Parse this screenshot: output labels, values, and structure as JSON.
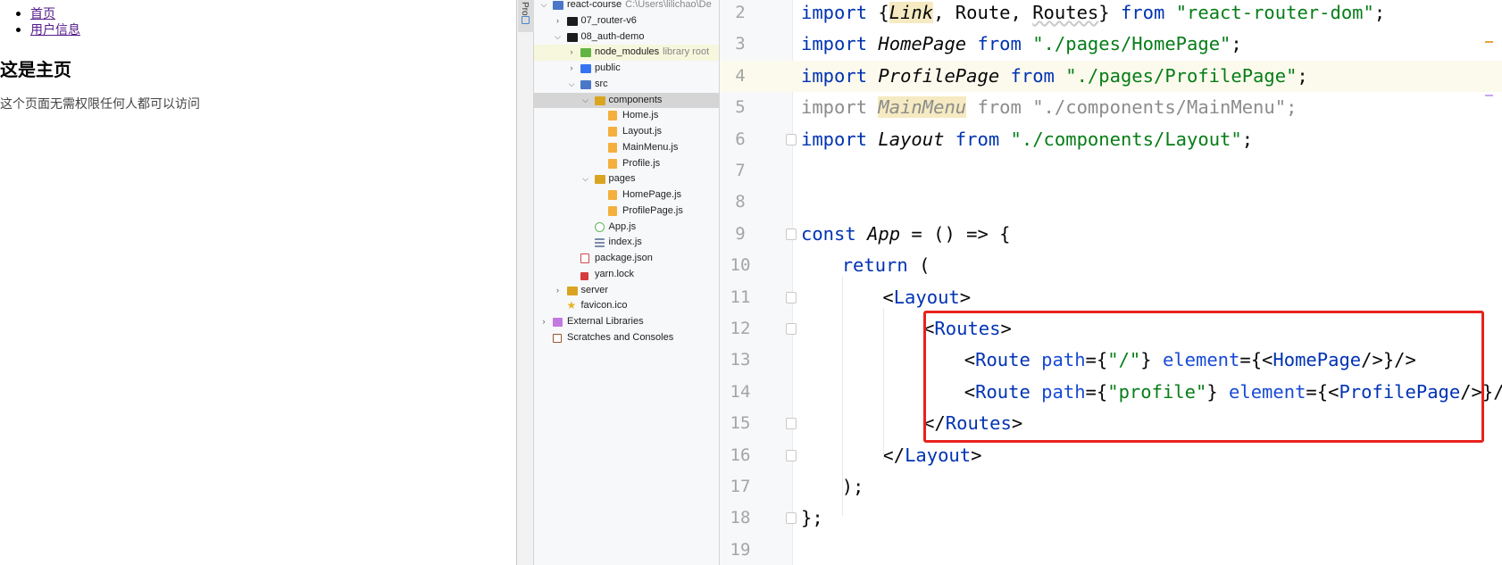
{
  "browser": {
    "nav": [
      {
        "label": "首页"
      },
      {
        "label": "用户信息"
      }
    ],
    "heading": "这是主页",
    "description": "这个页面无需权限任何人都可以访问"
  },
  "tool_strip": {
    "tab_label": "Pro"
  },
  "project_tree": {
    "rows": [
      {
        "label": "react-course",
        "sub": "C:\\Users\\lilichao\\De",
        "arrow": "v",
        "icon": "folder-srcblue"
      },
      {
        "label": "07_router-v6",
        "arrow": ">",
        "icon": "folder-black"
      },
      {
        "label": "08_auth-demo",
        "arrow": "v",
        "icon": "folder-black"
      },
      {
        "label": "node_modules",
        "sub": "library root",
        "arrow": ">",
        "icon": "folder-green"
      },
      {
        "label": "public",
        "arrow": ">",
        "icon": "folder-blue"
      },
      {
        "label": "src",
        "arrow": "v",
        "icon": "folder-srcblue"
      },
      {
        "label": "components",
        "arrow": "v",
        "icon": "folder"
      },
      {
        "label": "Home.js",
        "arrow": "",
        "icon": "js"
      },
      {
        "label": "Layout.js",
        "arrow": "",
        "icon": "js"
      },
      {
        "label": "MainMenu.js",
        "arrow": "",
        "icon": "js"
      },
      {
        "label": "Profile.js",
        "arrow": "",
        "icon": "js"
      },
      {
        "label": "pages",
        "arrow": "v",
        "icon": "folder"
      },
      {
        "label": "HomePage.js",
        "arrow": "",
        "icon": "js"
      },
      {
        "label": "ProfilePage.js",
        "arrow": "",
        "icon": "js"
      },
      {
        "label": "App.js",
        "arrow": "",
        "icon": "appjs"
      },
      {
        "label": "index.js",
        "arrow": "",
        "icon": "indexjs"
      },
      {
        "label": "package.json",
        "arrow": "",
        "icon": "json"
      },
      {
        "label": "yarn.lock",
        "arrow": "",
        "icon": "lock"
      },
      {
        "label": "server",
        "arrow": ">",
        "icon": "folder"
      },
      {
        "label": "favicon.ico",
        "arrow": "",
        "icon": "favicon"
      },
      {
        "label": "External Libraries",
        "arrow": ">",
        "icon": "extlib"
      },
      {
        "label": "Scratches and Consoles",
        "arrow": "",
        "icon": "scratch"
      }
    ]
  },
  "editor": {
    "inspections": {
      "errors": "1",
      "warnings": "4",
      "weak_warnings": "1"
    },
    "line_numbers": [
      "2",
      "3",
      "4",
      "5",
      "6",
      "7",
      "8",
      "9",
      "10",
      "11",
      "12",
      "13",
      "14",
      "15",
      "16",
      "17",
      "18",
      "19"
    ],
    "lines": {
      "l2": {
        "import": "import ",
        "brace_open": "{",
        "link": "Link",
        "comma1": ", Route, ",
        "routes": "Routes",
        "brace_close": "} ",
        "from": "from ",
        "src": "\"react-router-dom\"",
        "tail": ";"
      },
      "l3": {
        "import": "import ",
        "name": "HomePage",
        "from": " from ",
        "src": "\"./pages/HomePage\"",
        "tail": ";"
      },
      "l4": {
        "import": "import ",
        "name": "ProfilePage",
        "from": " from ",
        "src": "\"./pages/ProfilePage\"",
        "tail": ";"
      },
      "l5": {
        "import": "import ",
        "name": "MainMenu",
        "from": " from ",
        "src": "\"./components/MainMenu\"",
        "tail": ";"
      },
      "l6": {
        "import": "import ",
        "name": "Layout",
        "from": " from ",
        "src": "\"./components/Layout\"",
        "tail": ";"
      },
      "l9": {
        "const": "const ",
        "name": "App",
        "rest": " = () => {"
      },
      "l10": {
        "return": "return",
        "rest": " ("
      },
      "l11": {
        "open": "<",
        "tag": "Layout",
        "close": ">"
      },
      "l12": {
        "open": "<",
        "tag": "Routes",
        "close": ">"
      },
      "l13": {
        "open": "<",
        "tag": "Route",
        "attr1": " path",
        "eq1": "={",
        "val1": "\"/\"",
        "mid": "} ",
        "attr2": "element",
        "eq2": "={<",
        "comp": "HomePage",
        "end": "/>}/>"
      },
      "l14": {
        "open": "<",
        "tag": "Route",
        "attr1": " path",
        "eq1": "={",
        "val1": "\"profile\"",
        "mid": "} ",
        "attr2": "element",
        "eq2": "={<",
        "comp": "ProfilePage",
        "end": "/>}/>"
      },
      "l15": {
        "open": "</",
        "tag": "Routes",
        "close": ">"
      },
      "l16": {
        "open": "</",
        "tag": "Layout",
        "close": ">"
      },
      "l17": {
        "text": ");"
      },
      "l18": {
        "text": "};"
      }
    },
    "highlight_box_color": "#e8221d"
  }
}
